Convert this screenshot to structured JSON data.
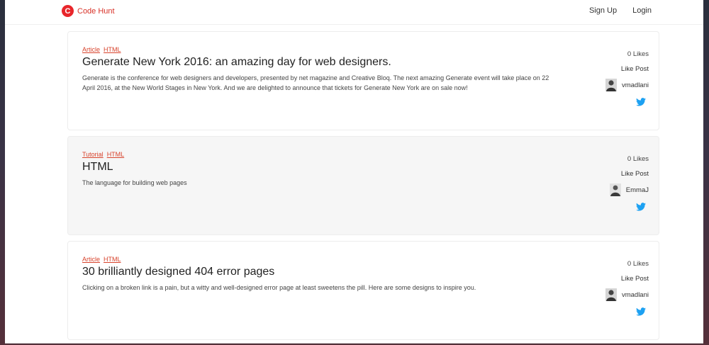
{
  "brand": {
    "logo_letter": "C",
    "name": "Code Hunt",
    "color": "#e8262b"
  },
  "nav": {
    "signup": "Sign Up",
    "login": "Login"
  },
  "posts": [
    {
      "tags": [
        "Article",
        "HTML"
      ],
      "title": "Generate New York 2016: an amazing day for web designers.",
      "description": "Generate is the conference for web designers and developers, presented by net magazine and Creative Bloq. The next amazing Generate event will take place on 22 April 2016, at the New World Stages in New York. And we are delighted to announce that tickets for Generate New York are on sale now!",
      "likes": "0 Likes",
      "like_label": "Like Post",
      "author": "vmadlani",
      "share_icon": "twitter-icon"
    },
    {
      "tags": [
        "Tutorial",
        "HTML"
      ],
      "title": "HTML",
      "description": "The language for building web pages",
      "likes": "0 Likes",
      "like_label": "Like Post",
      "author": "EmmaJ",
      "share_icon": "twitter-icon"
    },
    {
      "tags": [
        "Article",
        "HTML"
      ],
      "title": "30 brilliantly designed 404 error pages",
      "description": "Clicking on a broken link is a pain, but a witty and well-designed error page at least sweetens the pill. Here are some designs to inspire you.",
      "likes": "0 Likes",
      "like_label": "Like Post",
      "author": "vmadlani",
      "share_icon": "twitter-icon"
    }
  ],
  "colors": {
    "accent": "#d8432c",
    "twitter": "#1da1f2"
  }
}
